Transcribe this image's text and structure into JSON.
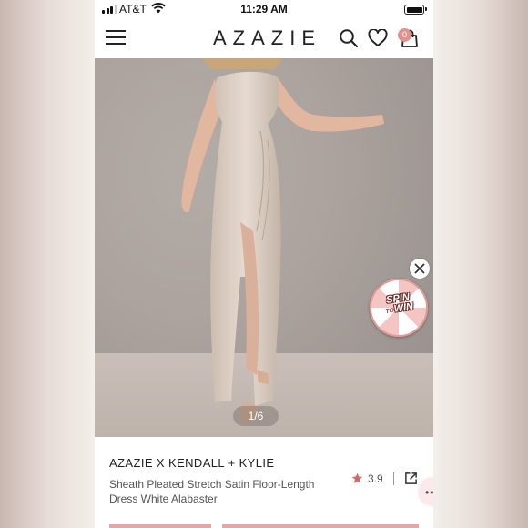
{
  "status_bar": {
    "carrier": "AT&T",
    "time": "11:29 AM"
  },
  "nav": {
    "logo": "AZAZIE",
    "cart_count": "0",
    "icons": [
      "menu-icon",
      "search-icon",
      "heart-icon",
      "bag-icon"
    ]
  },
  "product": {
    "image_counter": "1/6",
    "brand": "AZAZIE X KENDALL + KYLIE",
    "title": "Sheath Pleated Stretch Satin Floor-Length Dress White Alabaster",
    "rating": "3.9"
  },
  "promo": {
    "spin_line1": "SPIN",
    "spin_line2": "TO",
    "spin_line3": "WIN"
  },
  "colors": {
    "accent": "#e3928f",
    "star": "#d0676a",
    "dress": "#d8c9bc"
  }
}
